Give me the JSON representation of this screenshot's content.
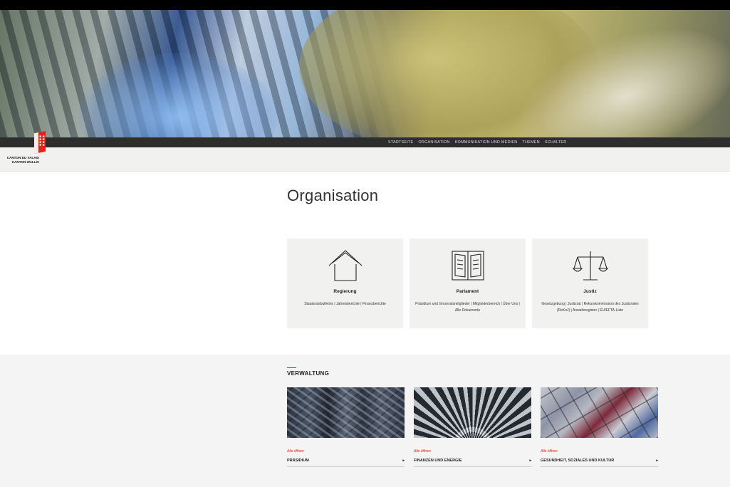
{
  "header": {
    "nav_items": [
      "STARTSEITE",
      "ORGANISATION",
      "KOMMUNIKATION UND MEDIEN",
      "THEMEN",
      "SCHALTER"
    ],
    "logo_line1": "CANTON DU VALAIS",
    "logo_line2": "KANTON WALLIS",
    "brand_color": "#e2231a"
  },
  "main": {
    "title": "Organisation",
    "cards": [
      {
        "icon": "house-icon",
        "title": "Regierung",
        "links": "Staatsratsbulletins | Jahresberichte | Finanzberichte"
      },
      {
        "icon": "open-book-icon",
        "title": "Parlament",
        "links": "Präsidium und Grossratsmitglieder | Mitgliederbereich | Über Uns | Alle Dokumente"
      },
      {
        "icon": "scales-icon",
        "title": "Justiz",
        "links": "Gesetzgebung | Justizrat | Rekurskommission des Justizrates (ReKoJ) | Anwaltsregister | EU/EFTA-Liste"
      }
    ]
  },
  "verwaltung": {
    "title": "VERWALTUNG",
    "tiles": [
      {
        "open_label": "Alle öffnen",
        "name": "PRÄSIDIUM"
      },
      {
        "open_label": "Alle öffnen",
        "name": "FINANZEN UND ENERGIE"
      },
      {
        "open_label": "Alle öffnen",
        "name": "GESUNDHEIT, SOZIALES UND KULTUR"
      }
    ]
  }
}
